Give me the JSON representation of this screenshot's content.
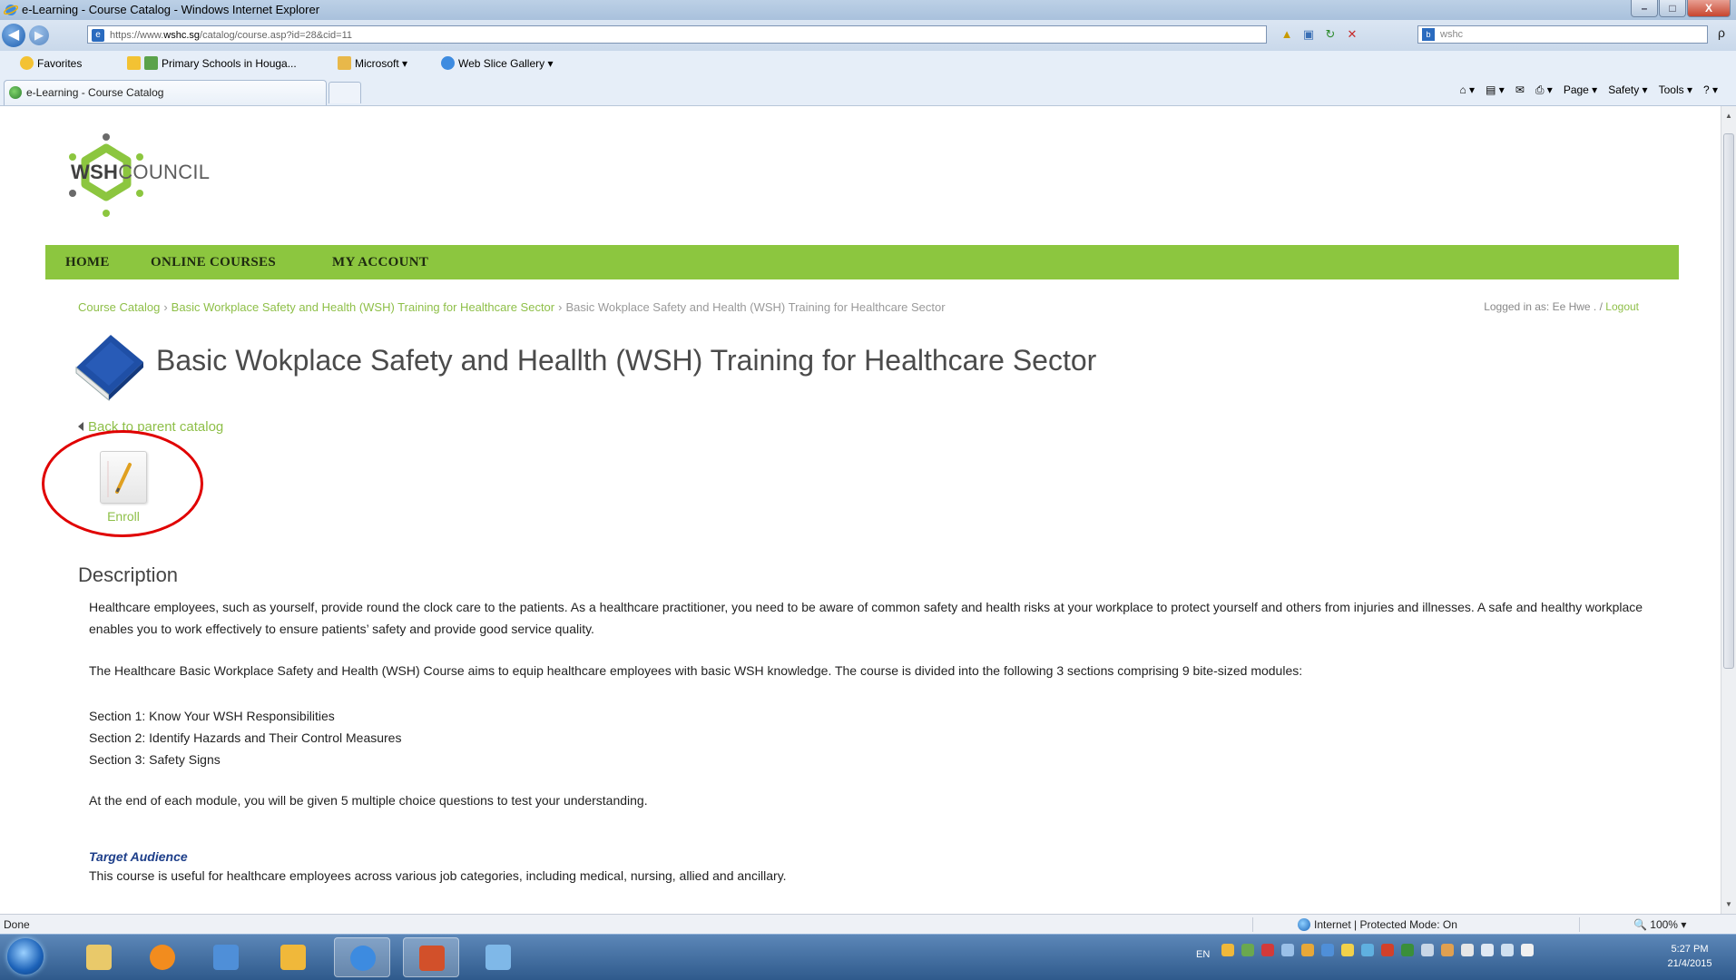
{
  "window": {
    "title": "e-Learning - Course Catalog - Windows Internet Explorer",
    "minimize": "–",
    "maximize": "□",
    "close": "X"
  },
  "address_bar": {
    "url_prefix": "https://www.",
    "url_domain": "wshc.sg",
    "url_path": "/catalog/course.asp?id=28&cid=11",
    "search_text": "wshc",
    "search_glyph": "ρ"
  },
  "favorites": {
    "label": "Favorites",
    "items": [
      {
        "label": "Primary Schools in Houga..."
      },
      {
        "label": "Microsoft ▾"
      },
      {
        "label": "Web Slice Gallery ▾"
      }
    ]
  },
  "tab": {
    "label": "e-Learning - Course Catalog"
  },
  "command_bar": {
    "items": [
      "Page ▾",
      "Safety ▾",
      "Tools ▾"
    ]
  },
  "site": {
    "logo_bold": "WSH",
    "logo_light": "COUNCIL",
    "nav": [
      "HOME",
      "ONLINE COURSES",
      "MY ACCOUNT"
    ],
    "breadcrumb": {
      "items": [
        "Course Catalog",
        "Basic Workplace Safety and Health (WSH) Training for Healthcare Sector"
      ],
      "current": "Basic Wokplace Safety and Health (WSH) Training for Healthcare Sector",
      "separator": "›"
    },
    "logged_in": {
      "prefix": "Logged in as: Ee Hwe .",
      "slash": "/",
      "logout": "Logout"
    },
    "course_title": "Basic Wokplace Safety and Heallth (WSH) Training for Healthcare Sector",
    "back_link": "Back to parent catalog",
    "enroll_label": "Enroll",
    "description": {
      "heading": "Description",
      "para1": "Healthcare employees, such as yourself, provide round the clock care to the patients. As a healthcare practitioner, you need to be aware of common safety and health risks at your workplace to protect yourself and others from injuries and illnesses. A safe and healthy workplace enables you to work effectively to ensure patients’ safety and provide good service quality.",
      "para2": "The Healthcare Basic Workplace Safety and Health (WSH) Course aims to equip healthcare employees with basic WSH knowledge. The course is divided into the following 3 sections comprising 9 bite-sized modules:",
      "sections": [
        "Section 1: Know Your WSH Responsibilities",
        "Section 2: Identify Hazards and Their Control Measures",
        "Section 3: Safety Signs"
      ],
      "para3": "At the end of each module, you will be given 5 multiple choice questions to test your understanding.",
      "target_heading": "Target Audience",
      "target_text": "This course is useful for healthcare employees across various job categories, including medical, nursing, allied and ancillary."
    }
  },
  "status_bar": {
    "left": "Done",
    "zone": "Internet | Protected Mode: On",
    "zoom": "100%"
  },
  "taskbar": {
    "language": "EN",
    "time": "5:27 PM",
    "date": "21/4/2015"
  },
  "colors": {
    "accent_green": "#8cc63f",
    "link_green": "#8ebf48",
    "annotation_red": "#e00000"
  }
}
